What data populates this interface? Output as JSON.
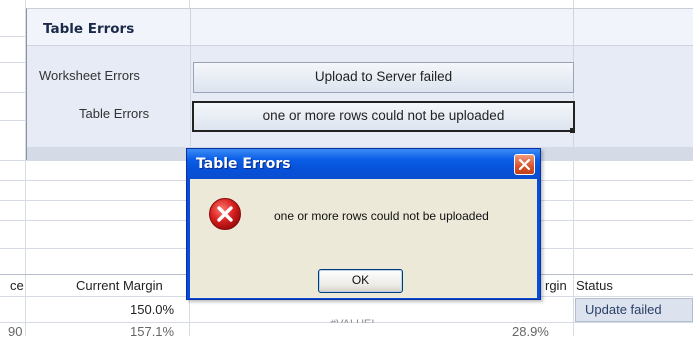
{
  "panel": {
    "title": "Table Errors",
    "rows": [
      {
        "label": "Worksheet Errors",
        "value": "Upload to Server failed"
      },
      {
        "label": "Table Errors",
        "value": "one or more rows could not be uploaded"
      }
    ]
  },
  "table": {
    "headers": {
      "col_a": "ce",
      "current_margin": "Current Margin",
      "margin": "rgin",
      "status": "Status"
    },
    "rows": [
      {
        "current_margin": "150.0%",
        "margin_partial": "#VALUE!",
        "status": "Update failed"
      },
      {
        "col_a": "90",
        "current_margin": "157.1%",
        "margin": "28.9%"
      }
    ]
  },
  "dialog": {
    "title": "Table Errors",
    "message": "one or more rows could not be uploaded",
    "ok_label": "OK",
    "icon": "error-icon"
  },
  "colors": {
    "titlebar": "#0a5ee6",
    "dialog_body": "#ece9d8",
    "panel_bg": "#e6ebf5",
    "error_red": "#d32020"
  }
}
